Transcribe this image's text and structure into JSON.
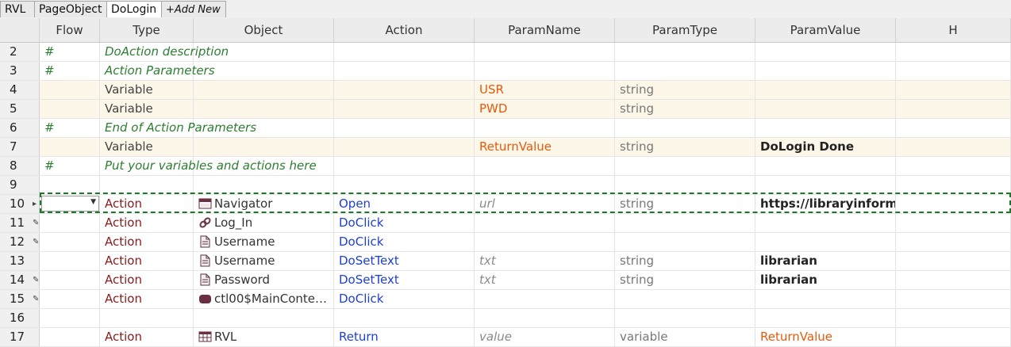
{
  "tabs": [
    "RVL",
    "PageObject",
    "DoLogin",
    "+Add New"
  ],
  "columns": [
    "Flow",
    "Type",
    "Object",
    "Action",
    "ParamName",
    "ParamType",
    "ParamValue",
    "H"
  ],
  "rows": [
    {
      "num": "2",
      "mark": "",
      "flow": "#",
      "type": "DoAction description",
      "object": "",
      "action": "",
      "pname": "",
      "ptype": "",
      "pval": "",
      "kind": "comment"
    },
    {
      "num": "3",
      "mark": "",
      "flow": "#",
      "type": "Action Parameters",
      "object": "",
      "action": "",
      "pname": "",
      "ptype": "",
      "pval": "",
      "kind": "comment"
    },
    {
      "num": "4",
      "mark": "",
      "flow": "",
      "type": "Variable",
      "object": "",
      "action": "",
      "pname": "USR",
      "ptype": "string",
      "pval": "",
      "kind": "var"
    },
    {
      "num": "5",
      "mark": "",
      "flow": "",
      "type": "Variable",
      "object": "",
      "action": "",
      "pname": "PWD",
      "ptype": "string",
      "pval": "",
      "kind": "var"
    },
    {
      "num": "6",
      "mark": "",
      "flow": "#",
      "type": "End of Action Parameters",
      "object": "",
      "action": "",
      "pname": "",
      "ptype": "",
      "pval": "",
      "kind": "comment"
    },
    {
      "num": "7",
      "mark": "",
      "flow": "",
      "type": "Variable",
      "object": "",
      "action": "",
      "pname": "ReturnValue",
      "ptype": "string",
      "pval": "DoLogin Done",
      "kind": "var"
    },
    {
      "num": "8",
      "mark": "",
      "flow": "#",
      "type": "Put your variables and actions here",
      "object": "",
      "action": "",
      "pname": "",
      "ptype": "",
      "pval": "",
      "kind": "comment"
    },
    {
      "num": "9",
      "mark": "",
      "flow": "",
      "type": "",
      "object": "",
      "action": "",
      "pname": "",
      "ptype": "",
      "pval": "",
      "kind": "empty"
    },
    {
      "num": "10",
      "mark": "▸",
      "flow": "",
      "type": "Action",
      "object": "Navigator",
      "icon": "navigator-icon",
      "action": "Open",
      "pname": "url",
      "ptype": "string",
      "pval": "https://libraryinformationsystem…",
      "kind": "action"
    },
    {
      "num": "11",
      "mark": "✎",
      "flow": "",
      "type": "Action",
      "object": "Log_In",
      "icon": "link-icon",
      "action": "DoClick",
      "pname": "",
      "ptype": "",
      "pval": "",
      "kind": "action"
    },
    {
      "num": "12",
      "mark": "✎",
      "flow": "",
      "type": "Action",
      "object": "Username",
      "icon": "document-icon",
      "action": "DoClick",
      "pname": "",
      "ptype": "",
      "pval": "",
      "kind": "action"
    },
    {
      "num": "13",
      "mark": "",
      "flow": "",
      "type": "Action",
      "object": "Username",
      "icon": "document-icon",
      "action": "DoSetText",
      "pname": "txt",
      "ptype": "string",
      "pval": "librarian",
      "kind": "action"
    },
    {
      "num": "14",
      "mark": "✎",
      "flow": "",
      "type": "Action",
      "object": "Password",
      "icon": "document-icon",
      "action": "DoSetText",
      "pname": "txt",
      "ptype": "string",
      "pval": "librarian",
      "kind": "action"
    },
    {
      "num": "15",
      "mark": "✎",
      "flow": "",
      "type": "Action",
      "object": "ctl00$MainConte…",
      "icon": "button-icon",
      "action": "DoClick",
      "pname": "",
      "ptype": "",
      "pval": "",
      "kind": "action"
    },
    {
      "num": "16",
      "mark": "",
      "flow": "",
      "type": "",
      "object": "",
      "action": "",
      "pname": "",
      "ptype": "",
      "pval": "",
      "kind": "empty"
    },
    {
      "num": "17",
      "mark": "",
      "flow": "",
      "type": "Action",
      "object": "RVL",
      "icon": "table-icon",
      "action": "Return",
      "pname": "value",
      "ptype": "variable",
      "pval": "ReturnValue",
      "kind": "action-return"
    }
  ]
}
